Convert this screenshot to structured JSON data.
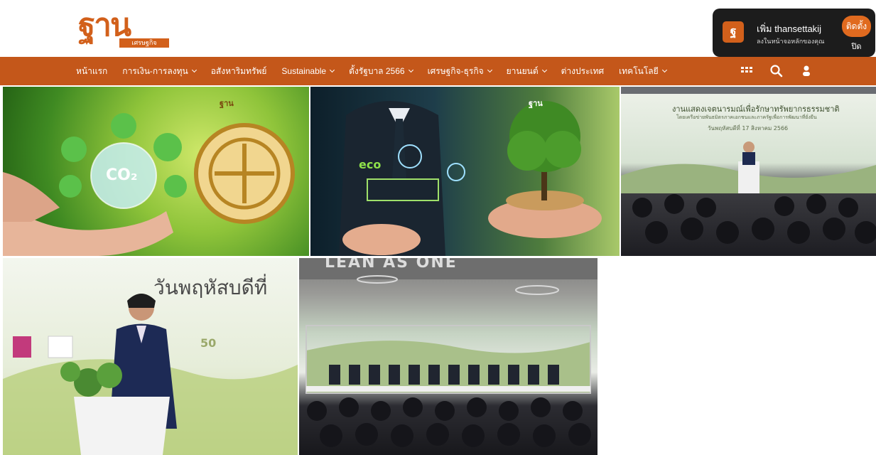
{
  "header": {
    "logo_text": "ฐาน",
    "logo_subtext": "เศรษฐกิจ"
  },
  "install_prompt": {
    "logo_text": "ฐ",
    "title": "เพิ่ม thansettakij",
    "subtitle": "ลงในหน้าจอหลักของคุณ",
    "install_label": "ติดตั้ง",
    "close_label": "ปิด"
  },
  "nav": {
    "items": [
      {
        "label": "หน้าแรก",
        "dropdown": false
      },
      {
        "label": "การเงิน-การลงทุน",
        "dropdown": true
      },
      {
        "label": "อสังหาริมทรัพย์",
        "dropdown": false
      },
      {
        "label": "Sustainable",
        "dropdown": true
      },
      {
        "label": "ตั้งรัฐบาล 2566",
        "dropdown": true
      },
      {
        "label": "เศรษฐกิจ-ธุรกิจ",
        "dropdown": true
      },
      {
        "label": "ยานยนต์",
        "dropdown": true
      },
      {
        "label": "ต่างประเทศ",
        "dropdown": false
      },
      {
        "label": "เทคโนโลยี",
        "dropdown": true
      }
    ],
    "icons": [
      "grid-icon",
      "search-icon",
      "user-icon"
    ]
  },
  "photos": {
    "p1": {
      "emblem_text": "ฐาน",
      "co2_text": "CO₂"
    },
    "p2": {
      "emblem_text": "ฐาน",
      "eco_text": "eco"
    },
    "p3": {
      "title": "งานแสดงเจตนารมณ์เพื่อรักษาทรัพยากรธรรมชาติ",
      "subtitle": "โดยเครือข่ายพันธมิตรภาคเอกชนและภาครัฐเพื่อการพัฒนาที่ยั่งยืน",
      "date": "วันพฤหัสบดีที่ 17 สิงหาคม 2566"
    },
    "p4": {
      "title": "วันพฤหัสบดีที่",
      "badge": "50"
    },
    "p5": {
      "banner": "LEAN AS ONE"
    }
  },
  "colors": {
    "brand": "#d2601b",
    "navbar": "#c4571a",
    "install_bg": "#1c1c1c",
    "install_btn": "#e06a1f"
  }
}
